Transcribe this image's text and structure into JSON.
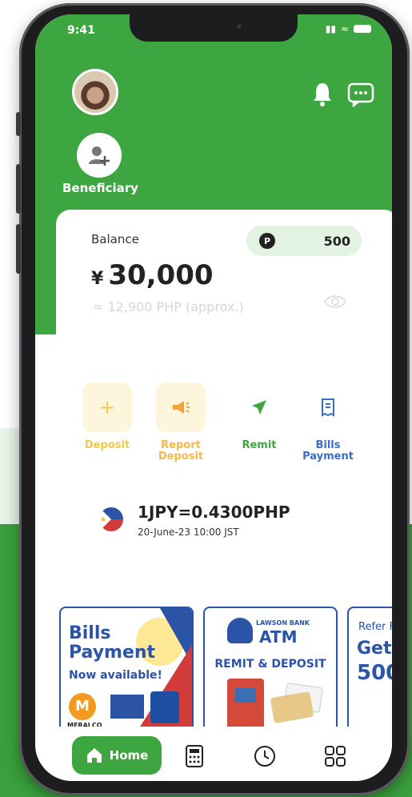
{
  "status": {
    "time": "9:41"
  },
  "header": {
    "beneficiary_label": "Beneficiary"
  },
  "balance": {
    "label": "Balance",
    "points_icon": "P",
    "points": "500",
    "currency_symbol": "¥",
    "amount": "30,000",
    "approx": "= 12,900 PHP (approx.)"
  },
  "actions": [
    {
      "label_lines": [
        "Deposit"
      ],
      "icon": "plus-icon",
      "color": "#f2c84b",
      "bg": "#fdf6dc"
    },
    {
      "label_lines": [
        "Report",
        "Deposit"
      ],
      "icon": "megaphone-icon",
      "color": "#f2b94b",
      "bg": "#fdf6dc"
    },
    {
      "label_lines": [
        "Remit"
      ],
      "icon": "send-icon",
      "color": "#3ea640",
      "bg": "transparent"
    },
    {
      "label_lines": [
        "Bills",
        "Payment"
      ],
      "icon": "receipt-icon",
      "color": "#3a6fc2",
      "bg": "transparent"
    }
  ],
  "rate": {
    "text": "1JPY=0.4300PHP",
    "timestamp": "20-June-23 10:00 JST"
  },
  "banners": {
    "bills": {
      "title_1": "Bills",
      "title_2": "Payment",
      "subtitle": "Now available!",
      "logo_text": "MERALCO"
    },
    "atm": {
      "bank": "LAWSON BANK",
      "title": "ATM",
      "subtitle": "REMIT & DEPOSIT"
    },
    "refer": {
      "line1": "Refer F",
      "line2": "Get",
      "line3": "500"
    }
  },
  "tabs": {
    "home_label": "Home"
  },
  "colors": {
    "brand_green": "#3ea640",
    "accent_blue": "#2b53a6"
  }
}
